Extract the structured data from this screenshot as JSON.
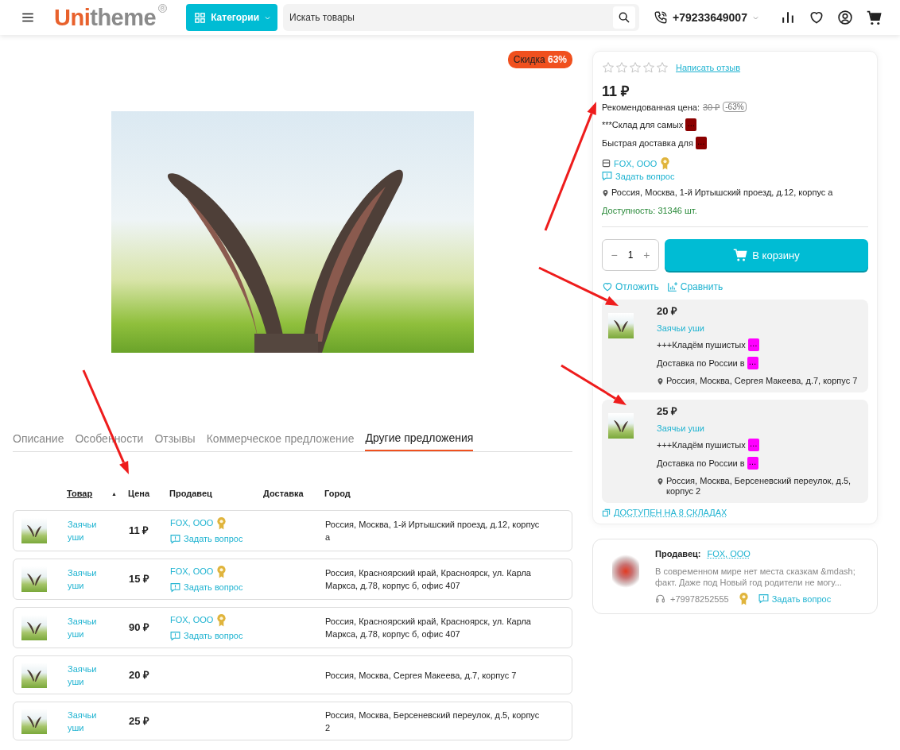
{
  "header": {
    "logo": {
      "part_1": "Uni",
      "part_2": "theme"
    },
    "trademark": "®",
    "categories_button": "Категории",
    "search": {
      "placeholder": "Искать товары"
    },
    "phone": "+79233649007"
  },
  "product": {
    "discount_badge": "Скидка **63%**"
  },
  "tabs": [
    {
      "label": "Описание",
      "selected": false
    },
    {
      "label": "Особенности",
      "selected": false
    },
    {
      "label": "Отзывы",
      "selected": false
    },
    {
      "label": "Коммерческое предложение",
      "selected": false
    },
    {
      "label": "Другие предложения",
      "selected": true
    }
  ],
  "offers_table": {
    "sort_arrow": "▲",
    "columns": [
      {
        "label": "Товар",
        "sorted": true
      },
      {
        "label": "Цена",
        "sorted": false
      },
      {
        "label": "Продавец",
        "sorted": false
      },
      {
        "label": "Доставка",
        "sorted": false
      },
      {
        "label": "Город",
        "sorted": false
      }
    ],
    "rows": [
      {
        "product": "Заячьи уши",
        "price": "11 ₽",
        "seller": "FOX, ООО",
        "verified": true,
        "ask_link": "Задать вопрос",
        "city": "Россия, Москва, 1-й Иртышский проезд, д.12, корпус а"
      },
      {
        "product": "Заячьи уши",
        "price": "15 ₽",
        "seller": "FOX, ООО",
        "verified": true,
        "ask_link": "Задать вопрос",
        "city": "Россия, Красноярский край, Красноярск, ул. Карла Маркса, д.78, корпус б, офис 407"
      },
      {
        "product": "Заячьи уши",
        "price": "90 ₽",
        "seller": "FOX, ООО",
        "verified": true,
        "ask_link": "Задать вопрос",
        "city": "Россия, Красноярский край, Красноярск, ул. Карла Маркса, д.78, корпус б, офис 407"
      },
      {
        "product": "Заячьи уши",
        "price": "20 ₽",
        "city": "Россия, Москва, Сергея Макеева, д.7, корпус 7"
      },
      {
        "product": "Заячьи уши",
        "price": "25 ₽",
        "city": "Россия, Москва, Берсеневский переулок, д.5, корпус 2"
      }
    ]
  },
  "buy_panel": {
    "stars": 0,
    "review_link": "Написать отзыв",
    "price": "11 ₽",
    "recommended": {
      "label": "Рекомендованная цена:",
      "old_price": "30 ₽",
      "discount": "-63%"
    },
    "notes": [
      {
        "text": "***Склад для самых",
        "tag": "…",
        "color": "#8b0000"
      },
      {
        "text": "Быстрая доставка для",
        "tag": "…",
        "color": "#8b0000"
      }
    ],
    "seller": "FOX, ООО",
    "verified": true,
    "ask_link": "Задать вопрос",
    "address": "Россия, Москва, 1-й Иртышский проезд, д.12, корпус а",
    "availability": "Доступность: 31346 шт.",
    "quantity": {
      "minus": "−",
      "value": "1",
      "plus": "+"
    },
    "cart_button": "В корзину",
    "wishlist_link": "Отложить",
    "compare_link": "Сравнить",
    "offers": [
      {
        "price": "20 ₽",
        "product": "Заячьи уши",
        "notes": [
          {
            "text": "+++Кладём пушистых",
            "tag": "…",
            "color": "#ff00ff"
          },
          {
            "text": "Доставка по России в",
            "tag": "…",
            "color": "#ff00ff"
          }
        ],
        "address": "Россия, Москва, Сергея Макеева, д.7, корпус 7"
      },
      {
        "price": "25 ₽",
        "product": "Заячьи уши",
        "notes": [
          {
            "text": "+++Кладём пушистых",
            "tag": "…",
            "color": "#ff00ff"
          },
          {
            "text": "Доставка по России в",
            "tag": "…",
            "color": "#ff00ff"
          }
        ],
        "address": "Россия, Москва, Берсеневский переулок, д.5, корпус 2"
      }
    ],
    "warehouses_link": "ДОСТУПЕН НА 8 СКЛАДАХ"
  },
  "seller_card": {
    "label": "Продавец:",
    "name": "FOX, ООО",
    "description": "В современном мире нет места сказкам &mdash; факт. Даже под Новый год родители не могу...",
    "phone": "+79978252555",
    "verified": true,
    "ask_link": "Задать вопрос"
  }
}
